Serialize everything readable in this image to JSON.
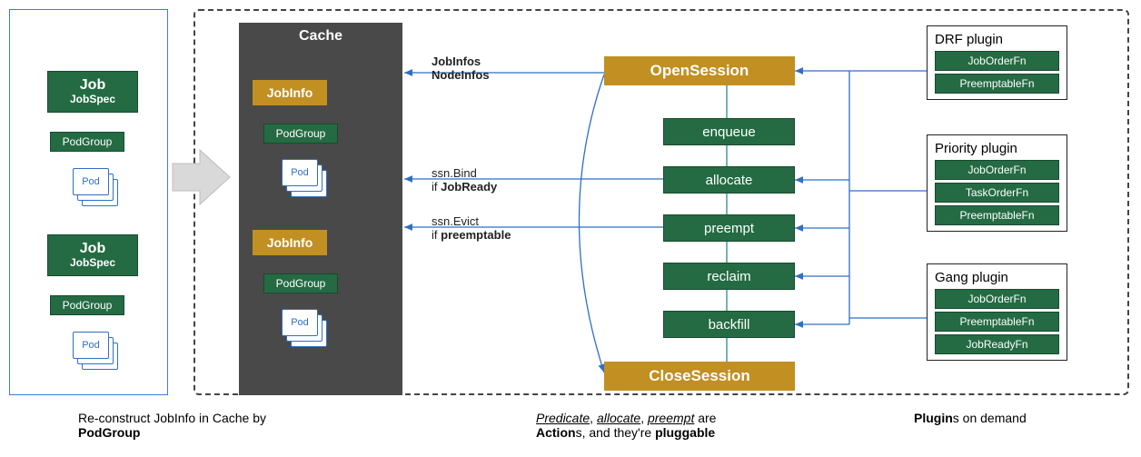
{
  "colors": {
    "green": "#246b43",
    "gold": "#c18f22",
    "blue": "#2f6fc4",
    "cache_bg": "#494949"
  },
  "left": {
    "job_label": "Job",
    "jobspec_label": "JobSpec",
    "podgroup_label": "PodGroup",
    "pod_label": "Pod"
  },
  "cache": {
    "title": "Cache",
    "jobinfo_label": "JobInfo",
    "podgroup_label": "PodGroup",
    "pod_label": "Pod"
  },
  "center": {
    "open_session": "OpenSession",
    "close_session": "CloseSession",
    "actions": [
      "enqueue",
      "allocate",
      "preempt",
      "reclaim",
      "backfill"
    ],
    "jobinfos_line1": "JobInfos",
    "jobinfos_line2": "NodeInfos",
    "bind_line1": "ssn.Bind",
    "bind_line2_prefix": "if ",
    "bind_line2_bold": "JobReady",
    "evict_line1": "ssn.Evict",
    "evict_line2_prefix": "if ",
    "evict_line2_bold": "preemptable"
  },
  "plugins": {
    "drf": {
      "title": "DRF plugin",
      "items": [
        "JobOrderFn",
        "PreemptableFn"
      ]
    },
    "priority": {
      "title": "Priority plugin",
      "items": [
        "JobOrderFn",
        "TaskOrderFn",
        "PreemptableFn"
      ]
    },
    "gang": {
      "title": "Gang plugin",
      "items": [
        "JobOrderFn",
        "PreemptableFn",
        "JobReadyFn"
      ]
    }
  },
  "footers": {
    "left_line1": "Re-construct JobInfo in Cache by",
    "left_line2_bold": "PodGroup",
    "mid_html": "<i><u>Predicate</u></i>, <i><u>allocate</u></i>, <i><u>preempt</u></i> are<br><b>Action</b>s, and they're <b>pluggable</b>",
    "right_html": "<b>Plugin</b>s on demand"
  }
}
